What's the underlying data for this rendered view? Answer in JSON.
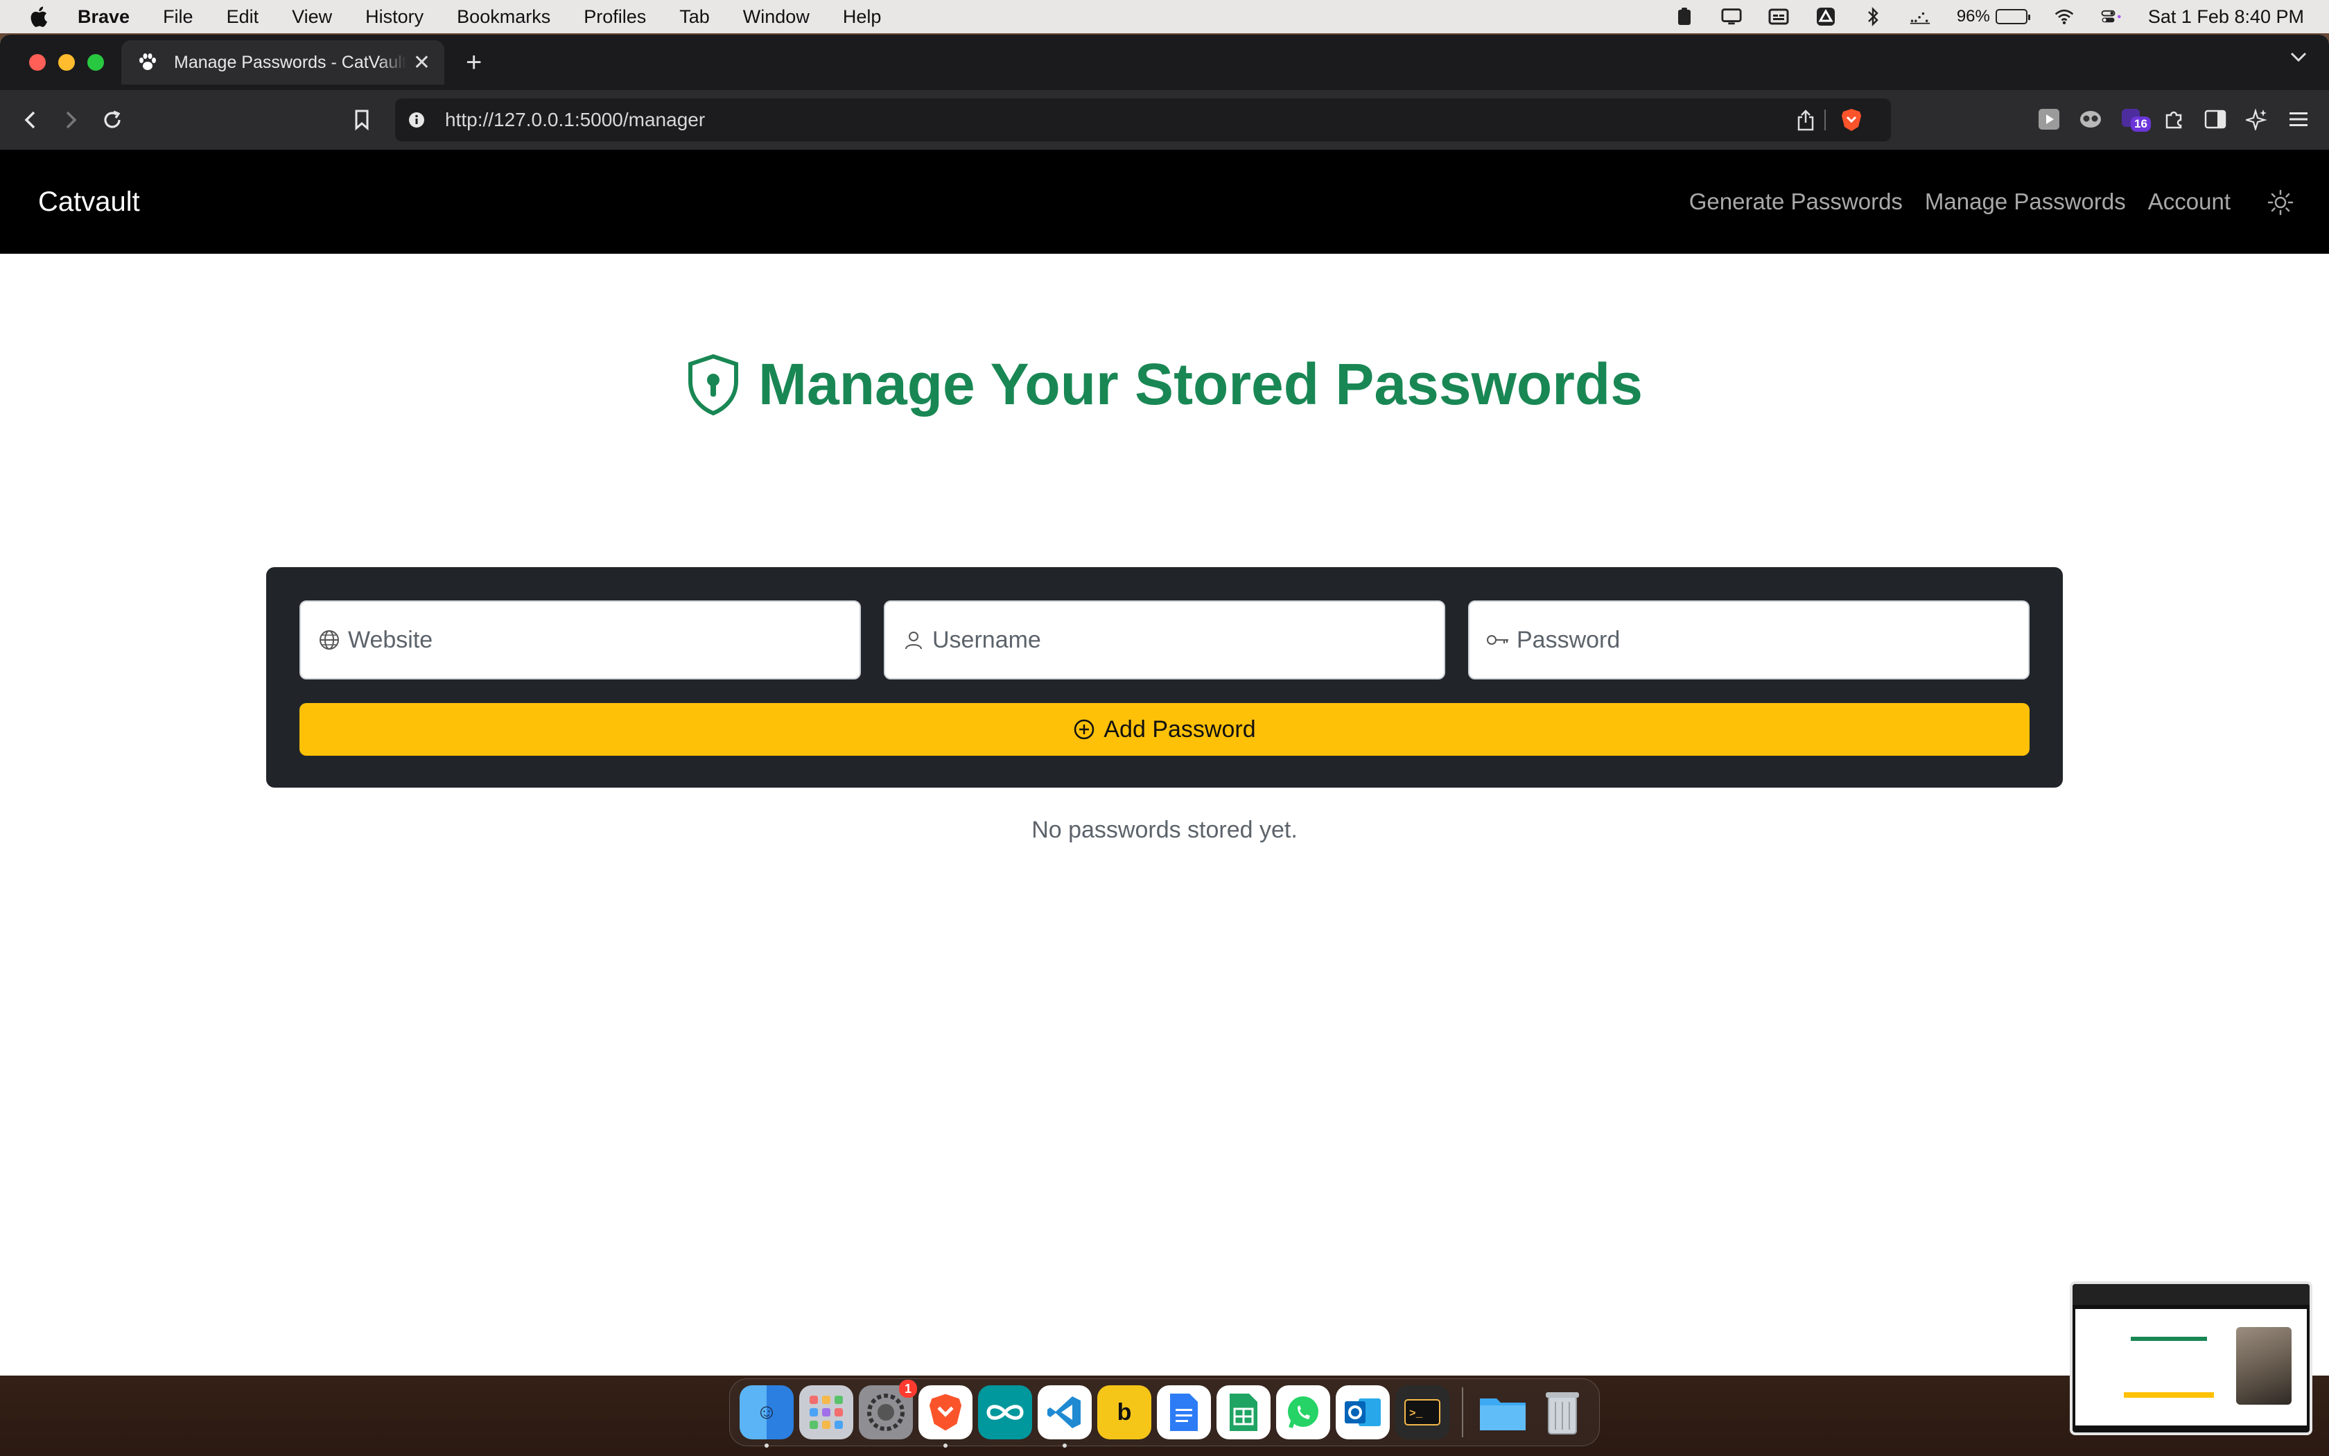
{
  "menubar": {
    "app_name": "Brave",
    "menus": [
      "File",
      "Edit",
      "View",
      "History",
      "Bookmarks",
      "Profiles",
      "Tab",
      "Window",
      "Help"
    ],
    "battery_percent": "96%",
    "battery_level": 0.96,
    "datetime": "Sat 1 Feb  8:40 PM",
    "status_icons": [
      "clipboard-icon",
      "display-icon",
      "caption-icon",
      "drive-icon",
      "bluetooth-icon",
      "activity-icon",
      "battery-icon",
      "wifi-icon",
      "control-center-icon"
    ]
  },
  "browser": {
    "tab": {
      "title": "Manage Passwords - CatVault",
      "favicon": "paw-icon"
    },
    "url": "http://127.0.0.1:5000/manager",
    "extension_badge": "16"
  },
  "app": {
    "brand": "Catvault",
    "nav": {
      "generate": "Generate Passwords",
      "manage": "Manage Passwords",
      "account": "Account"
    },
    "theme_toggle_icon": "sun-icon"
  },
  "main": {
    "title": "Manage Your Stored Passwords",
    "title_icon": "shield-lock-icon",
    "form": {
      "website_placeholder": "Website",
      "username_placeholder": "Username",
      "password_placeholder": "Password",
      "add_button": "Add Password"
    },
    "empty_message": "No passwords stored yet."
  },
  "dock": {
    "apps": [
      "Finder",
      "Launchpad",
      "System Settings",
      "Brave",
      "Arduino",
      "VS Code",
      "Bing",
      "Google Docs",
      "Google Sheets",
      "WhatsApp",
      "Outlook",
      "Terminal",
      "Files",
      "Trash"
    ],
    "settings_badge": "1"
  },
  "colors": {
    "accent_green": "#198754",
    "button_yellow": "#ffc107",
    "card_dark": "#212529",
    "navbar": "#000000"
  }
}
